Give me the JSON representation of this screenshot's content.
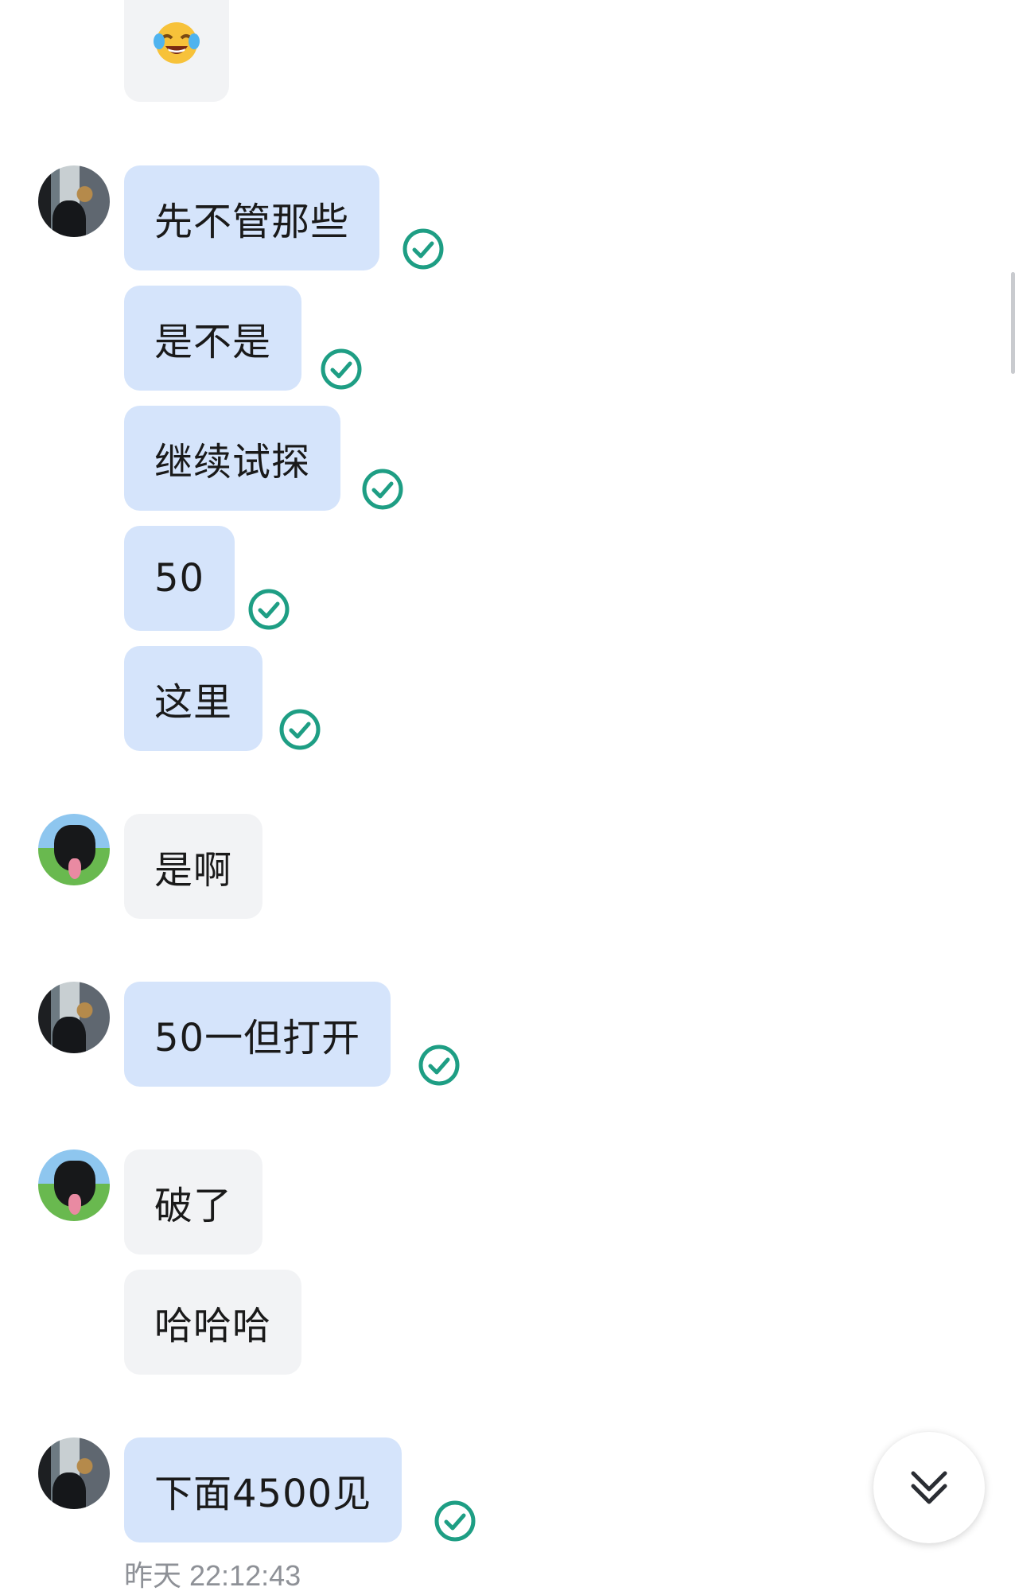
{
  "messages": [
    {
      "id": "m1",
      "text": "先不管那些"
    },
    {
      "id": "m2",
      "text": "是不是"
    },
    {
      "id": "m3",
      "text": "继续试探"
    },
    {
      "id": "m4",
      "text": "50"
    },
    {
      "id": "m5",
      "text": "这里"
    },
    {
      "id": "m6",
      "text": "是啊"
    },
    {
      "id": "m7",
      "text": "50一但打开"
    },
    {
      "id": "m8",
      "text": "破了"
    },
    {
      "id": "m9",
      "text": "哈哈哈"
    },
    {
      "id": "m10",
      "text": "下面4500见"
    }
  ],
  "top_emoji": {
    "icon": "crying-laughing-emoji-icon"
  },
  "status_icon": "read-check-icon",
  "colors": {
    "outgoing_bubble": "#d5e4fb",
    "incoming_bubble": "#f2f3f5",
    "check": "#1e9e84"
  },
  "timestamp": "昨天 22:12:43",
  "scroll_button": {
    "icon": "double-chevron-down-icon"
  }
}
